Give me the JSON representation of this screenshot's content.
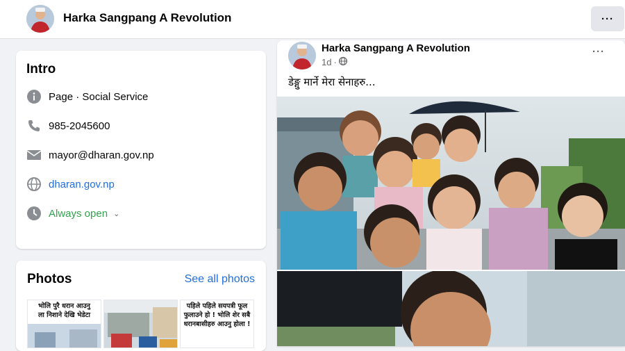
{
  "header": {
    "title": "Harka Sangpang A Revolution",
    "more_label": "···"
  },
  "intro": {
    "heading": "Intro",
    "rows": [
      {
        "icon": "info-icon",
        "text": "Page · Social Service"
      },
      {
        "icon": "phone-icon",
        "text": "985-2045600"
      },
      {
        "icon": "mail-icon",
        "text": "mayor@dharan.gov.np"
      },
      {
        "icon": "globe-icon",
        "text": "dharan.gov.np"
      },
      {
        "icon": "clock-icon",
        "text": "Always open"
      }
    ]
  },
  "photos": {
    "heading": "Photos",
    "see_all": "See all photos",
    "thumbs": [
      {
        "caption": "भोलि पुरै धरान आउनु\nला निशाने देखि भेडेटा"
      },
      {
        "caption": ""
      },
      {
        "caption": "पहिले पहिले सयपत्री फूल\nफुलाउने हो ! भोलि शेर सबै\nधरानबासीहरु आउनु होला !"
      }
    ]
  },
  "post": {
    "author": "Harka Sangpang A Revolution",
    "time": "1d",
    "caption": "डेङ्गु मार्ने मेरा सेनाहरु..."
  },
  "colors": {
    "link": "#216fdb",
    "open": "#31a24c",
    "background": "#f0f2f5"
  }
}
